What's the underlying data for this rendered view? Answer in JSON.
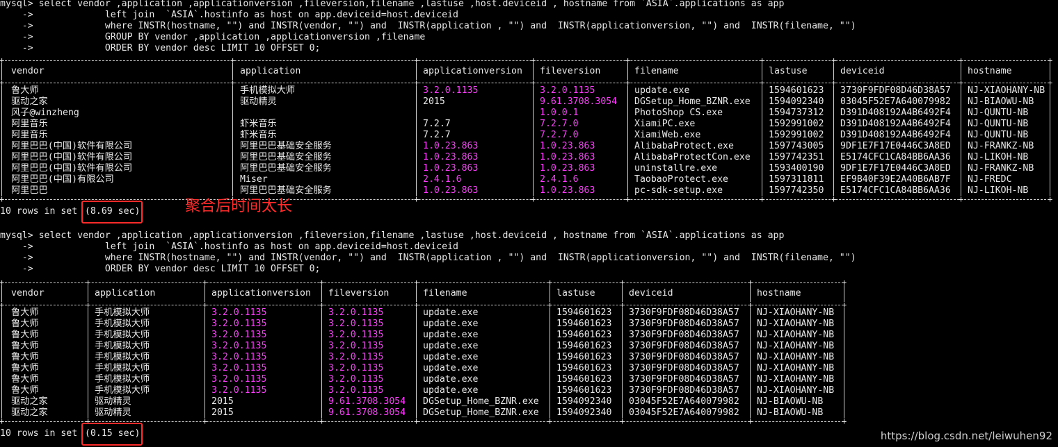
{
  "query1": {
    "lines": [
      "mysql> select vendor ,application ,applicationversion ,fileversion,filename ,lastuse ,host.deviceid , hostname from `ASIA`.applications as app",
      "    ->             left join  `ASIA`.hostinfo as host on app.deviceid=host.deviceid",
      "    ->             where INSTR(hostname, \"\") and INSTR(vendor, \"\") and  INSTR(application , \"\") and  INSTR(applicationversion, \"\") and  INSTR(filename, \"\")",
      "    ->             GROUP BY vendor ,application ,applicationversion ,filename",
      "    ->             ORDER BY vendor desc LIMIT 10 OFFSET 0;"
    ],
    "headers": [
      "vendor",
      "application",
      "applicationversion",
      "fileversion",
      "filename",
      "lastuse",
      "deviceid",
      "hostname"
    ],
    "rows": [
      [
        "鲁大师",
        "手机模拟大师",
        "3.2.0.1135",
        "3.2.0.1135",
        "update.exe",
        "1594601623",
        "3730F9FDF08D46D38A57",
        "NJ-XIAOHANY-NB"
      ],
      [
        "驱动之家",
        "驱动精灵",
        "2015",
        "9.61.3708.3054",
        "DGSetup_Home_BZNR.exe",
        "1594092340",
        "03045F52E7A640079982",
        "NJ-BIAOWU-NB"
      ],
      [
        "风子@winzheng",
        "",
        "",
        "1.0.0.1",
        "PhotoShop CS.exe",
        "1594737312",
        "D391D408192A4B6492F4",
        "NJ-QUNTU-NB"
      ],
      [
        "阿里音乐",
        "虾米音乐",
        "7.2.7",
        "7.2.7.0",
        "XiamiPC.exe",
        "1592991002",
        "D391D408192A4B6492F4",
        "NJ-QUNTU-NB"
      ],
      [
        "阿里音乐",
        "虾米音乐",
        "7.2.7",
        "7.2.7.0",
        "XiamiWeb.exe",
        "1592991002",
        "D391D408192A4B6492F4",
        "NJ-QUNTU-NB"
      ],
      [
        "阿里巴巴(中国)软件有限公司",
        "阿里巴巴基础安全服务",
        "1.0.23.863",
        "1.0.23.863",
        "AlibabaProtect.exe",
        "1597743005",
        "9DF1E7F17E0446C3A8ED",
        "NJ-FRANKZ-NB"
      ],
      [
        "阿里巴巴(中国)软件有限公司",
        "阿里巴巴基础安全服务",
        "1.0.23.863",
        "1.0.23.863",
        "AlibabaProtectCon.exe",
        "1597742351",
        "E5174CFC1CA84BB6AA36",
        "NJ-LIKOH-NB"
      ],
      [
        "阿里巴巴(中国)软件有限公司",
        "阿里巴巴基础安全服务",
        "1.0.23.863",
        "1.0.23.863",
        "uninstallre.exe",
        "1593400190",
        "9DF1E7F17E0446C3A8ED",
        "NJ-FRANKZ-NB"
      ],
      [
        "阿里巴巴(中国)有限公司",
        "Miser",
        "2.4.1.6",
        "2.4.1.6",
        "TaobaoProtect.exe",
        "1597311811",
        "EF9B40F39E2A40B6AB7F",
        "NJ-FREDC"
      ],
      [
        "阿里巴巴",
        "阿里巴巴基础安全服务",
        "1.0.23.863",
        "1.0.23.863",
        "pc-sdk-setup.exe",
        "1597742350",
        "E5174CFC1CA84BB6AA36",
        "NJ-LIKOH-NB"
      ]
    ],
    "magenta_cols": [
      2,
      3
    ],
    "magenta_rows_col2": [
      0,
      5,
      6,
      7,
      8,
      9
    ],
    "footer_prefix": "10 rows in set ",
    "footer_time": "(8.69 sec)",
    "annotation": "聚合后时间太长"
  },
  "query2": {
    "lines": [
      "mysql> select vendor ,application ,applicationversion ,fileversion,filename ,lastuse ,host.deviceid , hostname from `ASIA`.applications as app",
      "    ->             left join  `ASIA`.hostinfo as host on app.deviceid=host.deviceid",
      "    ->             where INSTR(hostname, \"\") and INSTR(vendor, \"\") and  INSTR(application , \"\") and  INSTR(applicationversion, \"\") and  INSTR(filename, \"\")",
      "    ->             ORDER BY vendor desc LIMIT 10 OFFSET 0;"
    ],
    "headers": [
      "vendor",
      "application",
      "applicationversion",
      "fileversion",
      "filename",
      "lastuse",
      "deviceid",
      "hostname"
    ],
    "rows": [
      [
        "鲁大师",
        "手机模拟大师",
        "3.2.0.1135",
        "3.2.0.1135",
        "update.exe",
        "1594601623",
        "3730F9FDF08D46D38A57",
        "NJ-XIAOHANY-NB"
      ],
      [
        "鲁大师",
        "手机模拟大师",
        "3.2.0.1135",
        "3.2.0.1135",
        "update.exe",
        "1594601623",
        "3730F9FDF08D46D38A57",
        "NJ-XIAOHANY-NB"
      ],
      [
        "鲁大师",
        "手机模拟大师",
        "3.2.0.1135",
        "3.2.0.1135",
        "update.exe",
        "1594601623",
        "3730F9FDF08D46D38A57",
        "NJ-XIAOHANY-NB"
      ],
      [
        "鲁大师",
        "手机模拟大师",
        "3.2.0.1135",
        "3.2.0.1135",
        "update.exe",
        "1594601623",
        "3730F9FDF08D46D38A57",
        "NJ-XIAOHANY-NB"
      ],
      [
        "鲁大师",
        "手机模拟大师",
        "3.2.0.1135",
        "3.2.0.1135",
        "update.exe",
        "1594601623",
        "3730F9FDF08D46D38A57",
        "NJ-XIAOHANY-NB"
      ],
      [
        "鲁大师",
        "手机模拟大师",
        "3.2.0.1135",
        "3.2.0.1135",
        "update.exe",
        "1594601623",
        "3730F9FDF08D46D38A57",
        "NJ-XIAOHANY-NB"
      ],
      [
        "鲁大师",
        "手机模拟大师",
        "3.2.0.1135",
        "3.2.0.1135",
        "update.exe",
        "1594601623",
        "3730F9FDF08D46D38A57",
        "NJ-XIAOHANY-NB"
      ],
      [
        "鲁大师",
        "手机模拟大师",
        "3.2.0.1135",
        "3.2.0.1135",
        "update.exe",
        "1594601623",
        "3730F9FDF08D46D38A57",
        "NJ-XIAOHANY-NB"
      ],
      [
        "驱动之家",
        "驱动精灵",
        "2015",
        "9.61.3708.3054",
        "DGSetup_Home_BZNR.exe",
        "1594092340",
        "03045F52E7A640079982",
        "NJ-BIAOWU-NB"
      ],
      [
        "驱动之家",
        "驱动精灵",
        "2015",
        "9.61.3708.3054",
        "DGSetup_Home_BZNR.exe",
        "1594092340",
        "03045F52E7A640079982",
        "NJ-BIAOWU-NB"
      ]
    ],
    "footer_prefix": "10 rows in set ",
    "footer_time": "(0.15 sec)"
  },
  "watermark": "https://blog.csdn.net/leiwuhen92",
  "colors": {
    "background": "#000000",
    "text": "#e8e8e8",
    "magenta": "#ff3cff",
    "highlight": "#ff2b2b"
  }
}
